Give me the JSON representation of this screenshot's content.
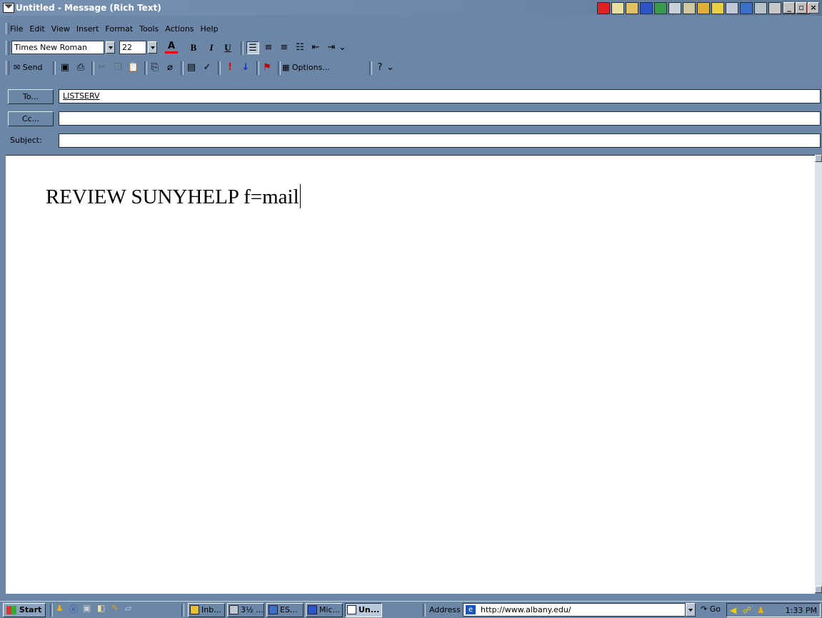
{
  "window": {
    "title": "Untitled - Message (Rich Text)"
  },
  "menu": [
    "File",
    "Edit",
    "View",
    "Insert",
    "Format",
    "Tools",
    "Actions",
    "Help"
  ],
  "formatting": {
    "font_name": "Times New Roman",
    "font_size": "22",
    "bold_label": "B",
    "italic_label": "I",
    "underline_label": "U"
  },
  "standard_toolbar": {
    "send_label": "Send",
    "options_label": "Options..."
  },
  "fields": {
    "to_label": "To...",
    "to_value": "LISTSERV",
    "cc_label": "Cc...",
    "cc_value": "",
    "subject_label": "Subject:",
    "subject_value": ""
  },
  "message": {
    "body_text": "REVIEW SUNYHELP f=mail"
  },
  "taskbar": {
    "start_label": "Start",
    "tasks": [
      "Inb...",
      "3½ ...",
      "ES...",
      "Mic...",
      "Un..."
    ],
    "address_label": "Address",
    "address_value": "http://www.albany.edu/",
    "go_label": "Go",
    "clock": "1:33 PM"
  }
}
